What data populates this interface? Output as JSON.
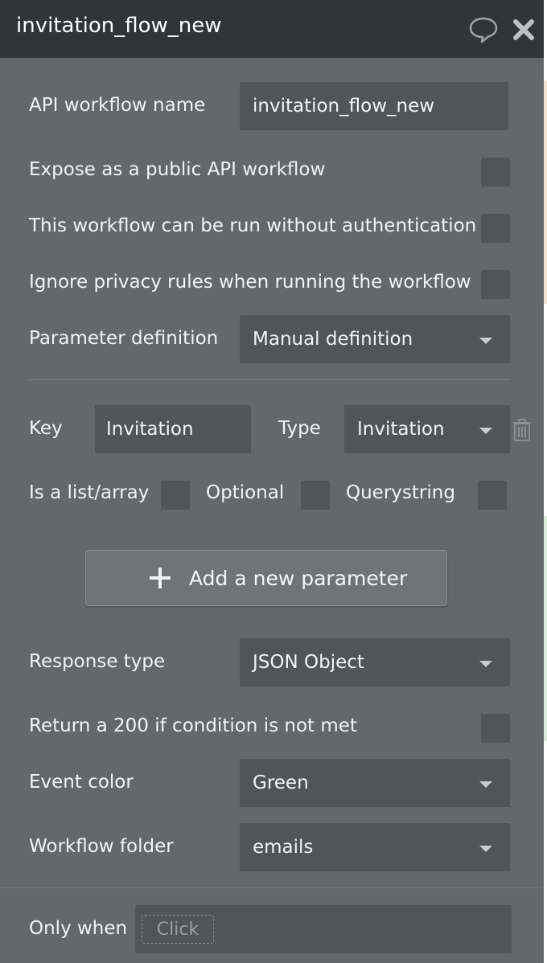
{
  "colors": {
    "panel_bg": "#62686c",
    "titlebar_bg": "#2f3538",
    "field_bg": "#4f5559",
    "button_bg": "#6e7478",
    "text": "#f1f3f4",
    "peek_orange": "#f5e3cf",
    "peek_green": "#d8ecd9"
  },
  "header": {
    "title": "invitation_flow_new",
    "comment_icon": "speech-bubble-icon",
    "close_icon": "close-x-icon"
  },
  "form": {
    "api_name_label": "API workflow name",
    "api_name_value": "invitation_flow_new",
    "expose_label": "Expose as a public API workflow",
    "no_auth_label": "This workflow can be run without authentication",
    "ignore_privacy_label": "Ignore privacy rules when running the workflow",
    "param_def_label": "Parameter definition",
    "param_def_value": "Manual definition"
  },
  "parameter": {
    "key_label": "Key",
    "key_value": "Invitation",
    "type_label": "Type",
    "type_value": "Invitation",
    "trash_icon": "trash-icon",
    "is_list_label": "Is a list/array",
    "optional_label": "Optional",
    "querystring_label": "Querystring"
  },
  "add_param": {
    "label": "Add a new parameter",
    "icon": "plus-icon"
  },
  "response": {
    "type_label": "Response type",
    "type_value": "JSON Object",
    "return200_label": "Return a 200 if condition is not met",
    "event_color_label": "Event color",
    "event_color_value": "Green",
    "folder_label": "Workflow folder",
    "folder_value": "emails"
  },
  "condition": {
    "label": "Only when",
    "placeholder": "Click"
  }
}
